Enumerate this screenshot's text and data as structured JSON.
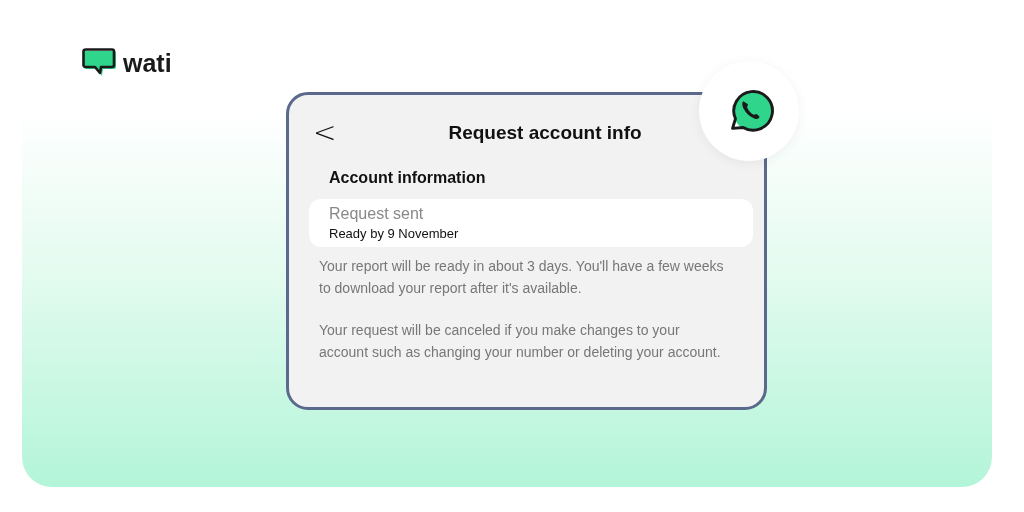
{
  "brand": {
    "name": "wati"
  },
  "screen": {
    "back": "<",
    "title": "Request account info",
    "section": "Account information",
    "status": {
      "title": "Request sent",
      "subtitle": "Ready by 9 November"
    },
    "paragraphs": [
      "Your report will be ready in about 3 days. You'll have a few weeks to download your report after it's available.",
      "Your request will be canceled if you make changes to your account such as changing your number or deleting your account."
    ]
  }
}
